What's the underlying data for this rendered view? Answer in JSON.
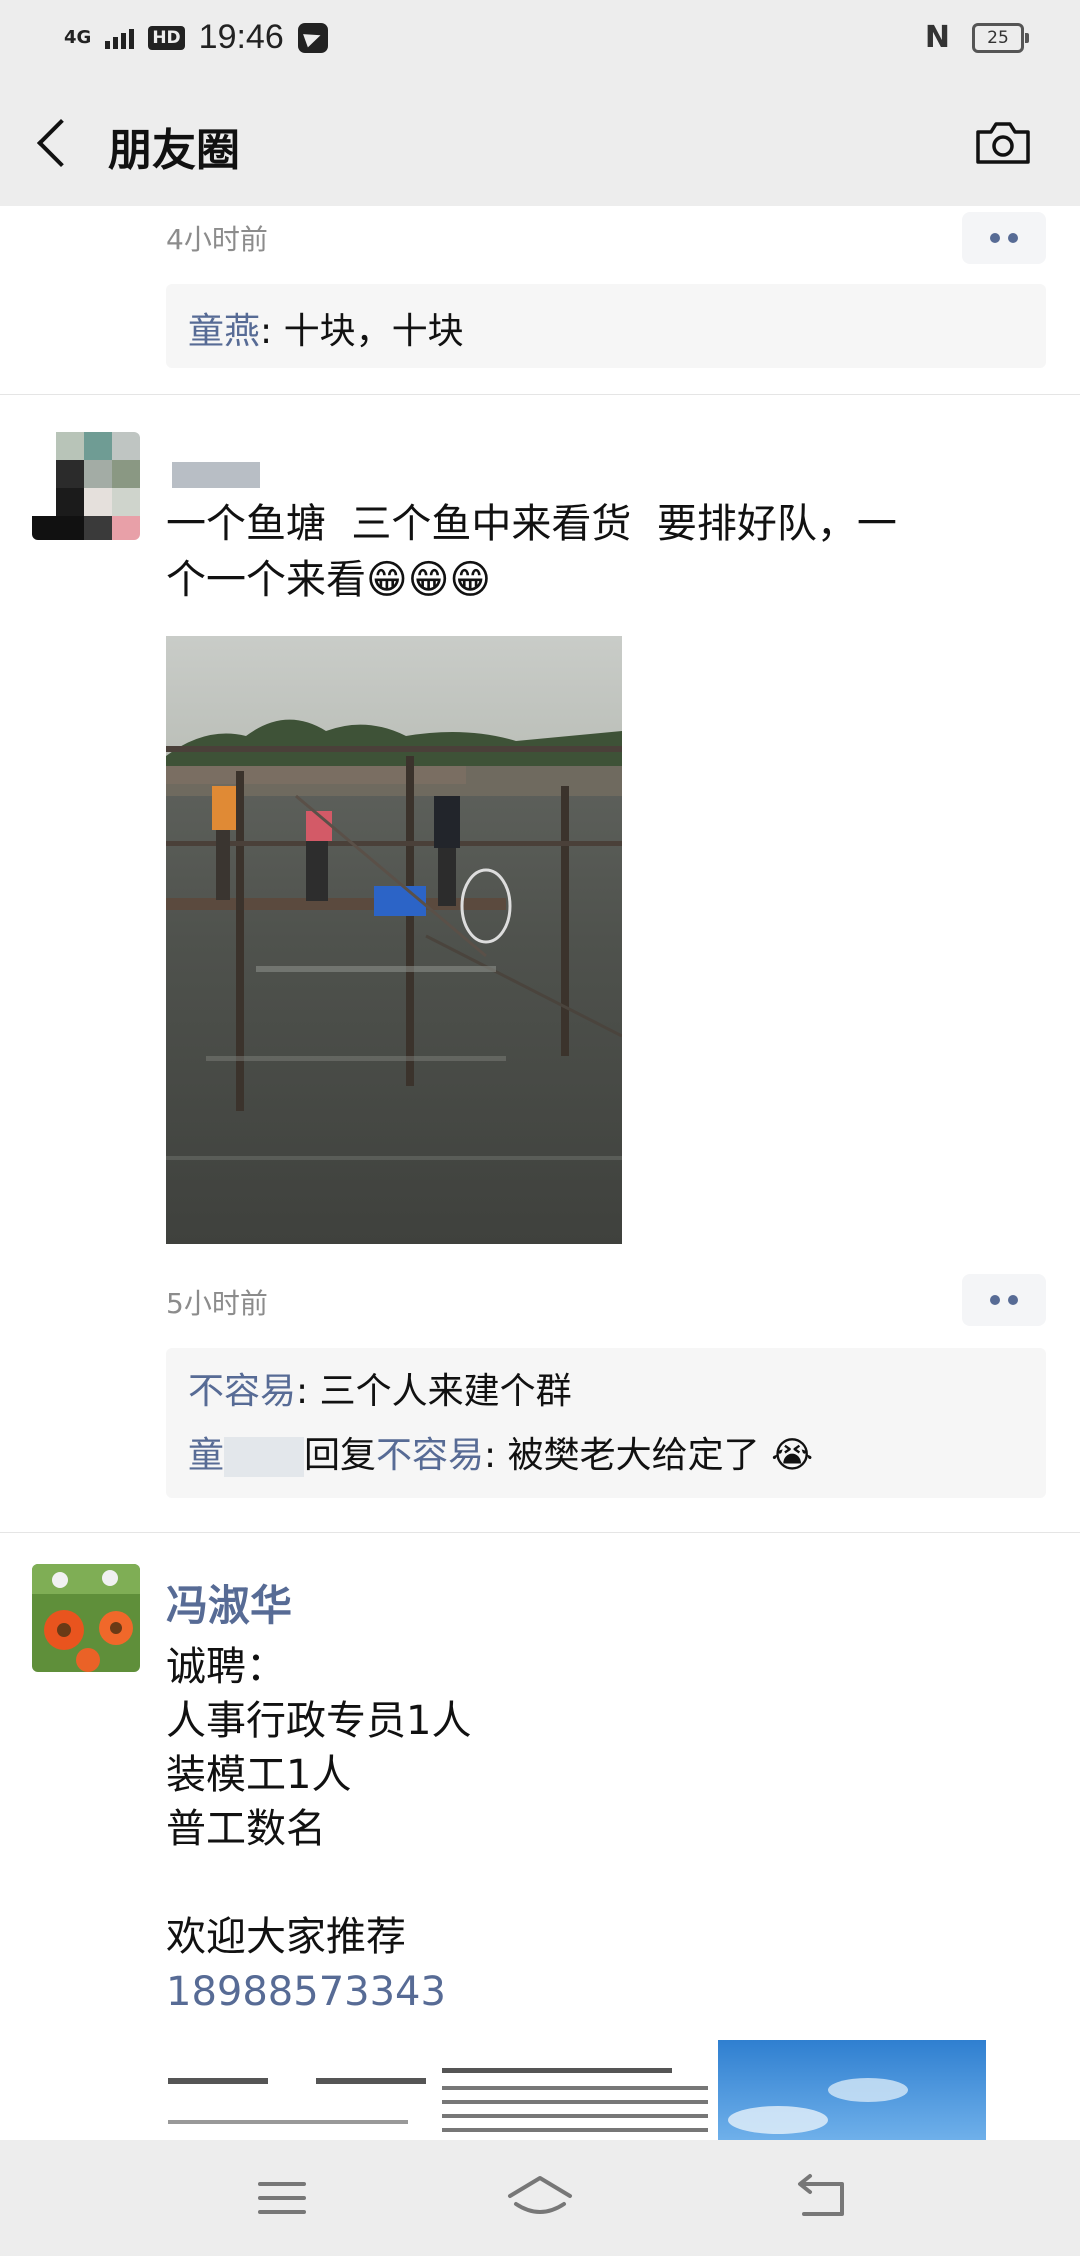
{
  "status_bar": {
    "network": "4G",
    "hd": "HD",
    "time": "19:46",
    "nfc": "N",
    "battery": "25"
  },
  "header": {
    "title": "朋友圈"
  },
  "post1": {
    "time": "4小时前",
    "comments": [
      {
        "name": "童燕",
        "text": ": 十块，十块"
      }
    ]
  },
  "post2": {
    "text": "一个鱼塘  三个鱼中来看货  要排好队，一\n个一个来看😁😁😁",
    "time": "5小时前",
    "comments": [
      {
        "name": "不容易",
        "text": ": 三个人来建个群"
      },
      {
        "prefix": "童",
        "reply": "回复",
        "name": "不容易",
        "text": ": 被樊老大给定了 😭"
      }
    ]
  },
  "post3": {
    "name": "冯淑华",
    "text": "诚聘：\n人事行政专员1人\n装模工1人\n普工数名\n\n欢迎大家推荐",
    "phone": "18988573343"
  },
  "colors": {
    "link": "#576b95",
    "bar_bg": "#ededed",
    "comment_bg": "#f6f6f6"
  }
}
